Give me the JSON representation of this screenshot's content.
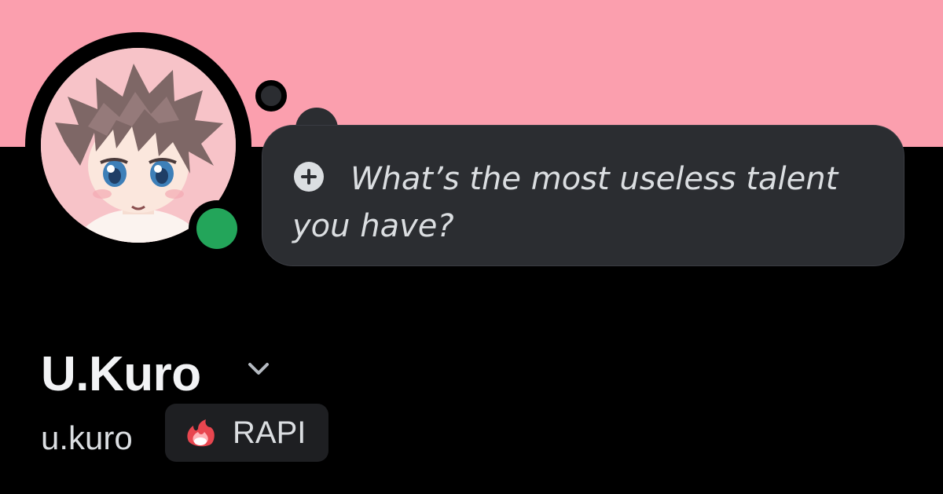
{
  "profile": {
    "display_name": "U.Kuro",
    "username": "u.kuro",
    "status": "online",
    "banner_color": "#fb9fae",
    "status_color": "#23a55a"
  },
  "prompt_bubble": {
    "text": "What’s the most useless talent you have?",
    "icon": "plus-circle-icon"
  },
  "clan_tag": {
    "label": "RAPI",
    "icon": "flame-badge-icon"
  },
  "icons": {
    "name_menu": "chevron-down-icon"
  }
}
